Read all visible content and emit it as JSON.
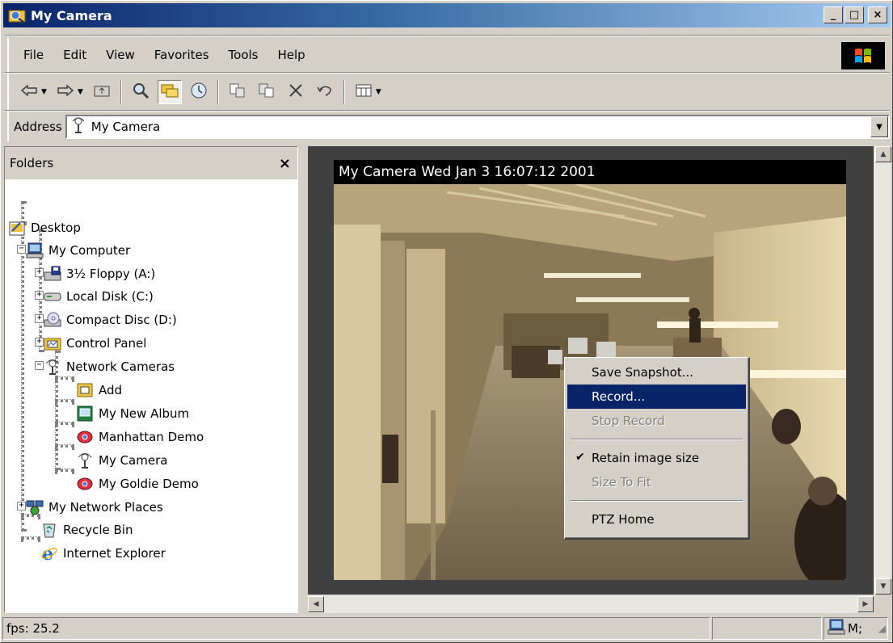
{
  "window": {
    "title": "My Camera",
    "icon": "camera-folder-icon",
    "buttons": {
      "minimize": "_",
      "maximize": "□",
      "close": "×"
    }
  },
  "menubar": {
    "items": [
      "File",
      "Edit",
      "View",
      "Favorites",
      "Tools",
      "Help"
    ]
  },
  "toolbar": {
    "icons": [
      "back-icon",
      "forward-icon",
      "up-folder-icon",
      "search-icon",
      "folders-icon",
      "history-icon",
      "move-to-icon",
      "copy-to-icon",
      "delete-icon",
      "undo-icon",
      "views-icon"
    ]
  },
  "address": {
    "label": "Address",
    "value": "My Camera"
  },
  "folders": {
    "title": "Folders",
    "close": "×",
    "items": [
      {
        "label": "Desktop",
        "icon": "desktop-icon"
      },
      {
        "label": "My Computer",
        "icon": "my-computer-icon"
      },
      {
        "label": "3½ Floppy (A:)",
        "icon": "floppy-drive-icon"
      },
      {
        "label": "Local Disk (C:)",
        "icon": "hard-disk-icon"
      },
      {
        "label": "Compact Disc (D:)",
        "icon": "cd-drive-icon"
      },
      {
        "label": "Control Panel",
        "icon": "control-panel-icon"
      },
      {
        "label": "Network Cameras",
        "icon": "network-camera-icon"
      },
      {
        "label": "Add",
        "icon": "add-camera-icon"
      },
      {
        "label": "My New Album",
        "icon": "album-icon"
      },
      {
        "label": "Manhattan Demo",
        "icon": "demo-camera-icon"
      },
      {
        "label": "My Camera",
        "icon": "camera-icon"
      },
      {
        "label": "My Goldie Demo",
        "icon": "demo-camera-icon"
      },
      {
        "label": "My Network Places",
        "icon": "network-places-icon"
      },
      {
        "label": "Recycle Bin",
        "icon": "recycle-bin-icon"
      },
      {
        "label": "Internet Explorer",
        "icon": "internet-explorer-icon"
      }
    ]
  },
  "camera": {
    "caption": "My Camera Wed Jan  3 16:07:12 2001"
  },
  "context_menu": {
    "items": [
      {
        "label": "Save Snapshot...",
        "state": "enabled"
      },
      {
        "label": "Record...",
        "state": "selected"
      },
      {
        "label": "Stop Record",
        "state": "disabled"
      },
      {
        "label": "Retain image size",
        "state": "checked"
      },
      {
        "label": "Size To Fit",
        "state": "disabled"
      },
      {
        "label": "PTZ Home",
        "state": "enabled"
      }
    ]
  },
  "status": {
    "fps": "fps: 25.2",
    "zone": "M;"
  },
  "colors": {
    "title_start": "#0a246a",
    "title_end": "#a6caf0",
    "selection": "#0a246a",
    "face": "#d4d0c8"
  }
}
